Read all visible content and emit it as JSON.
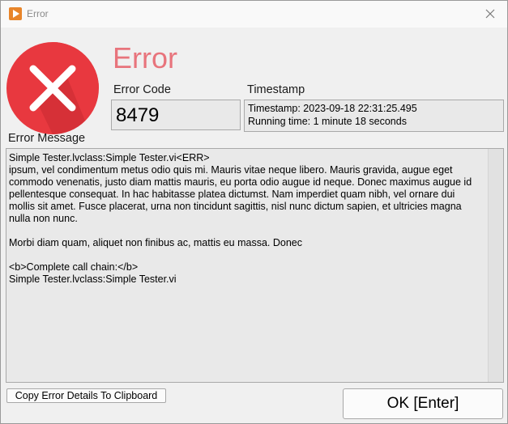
{
  "window": {
    "title": "Error",
    "app_icon": "labview-run-icon",
    "close_icon": "close-icon"
  },
  "header": {
    "icon": "error-x-icon",
    "heading": "Error",
    "heading_color": "#e8747c"
  },
  "error_code": {
    "label": "Error Code",
    "value": "8479"
  },
  "timestamp": {
    "label": "Timestamp",
    "line1": "Timestamp: 2023-09-18 22:31:25.495",
    "line2": "Running time: 1 minute 18 seconds"
  },
  "error_message": {
    "label": "Error Message",
    "text": "Simple Tester.lvclass:Simple Tester.vi<ERR>\nipsum, vel condimentum metus odio quis mi. Mauris vitae neque libero. Mauris gravida, augue eget commodo venenatis, justo diam mattis mauris, eu porta odio augue id neque. Donec maximus augue id pellentesque consequat. In hac habitasse platea dictumst. Nam imperdiet quam nibh, vel ornare dui mollis sit amet. Fusce placerat, urna non tincidunt sagittis, nisl nunc dictum sapien, et ultricies magna nulla non nunc.\n\nMorbi diam quam, aliquet non finibus ac, mattis eu massa. Donec\n\n<b>Complete call chain:</b>\nSimple Tester.lvclass:Simple Tester.vi"
  },
  "buttons": {
    "copy_label": "Copy Error Details To Clipboard",
    "ok_label": "OK [Enter]"
  }
}
